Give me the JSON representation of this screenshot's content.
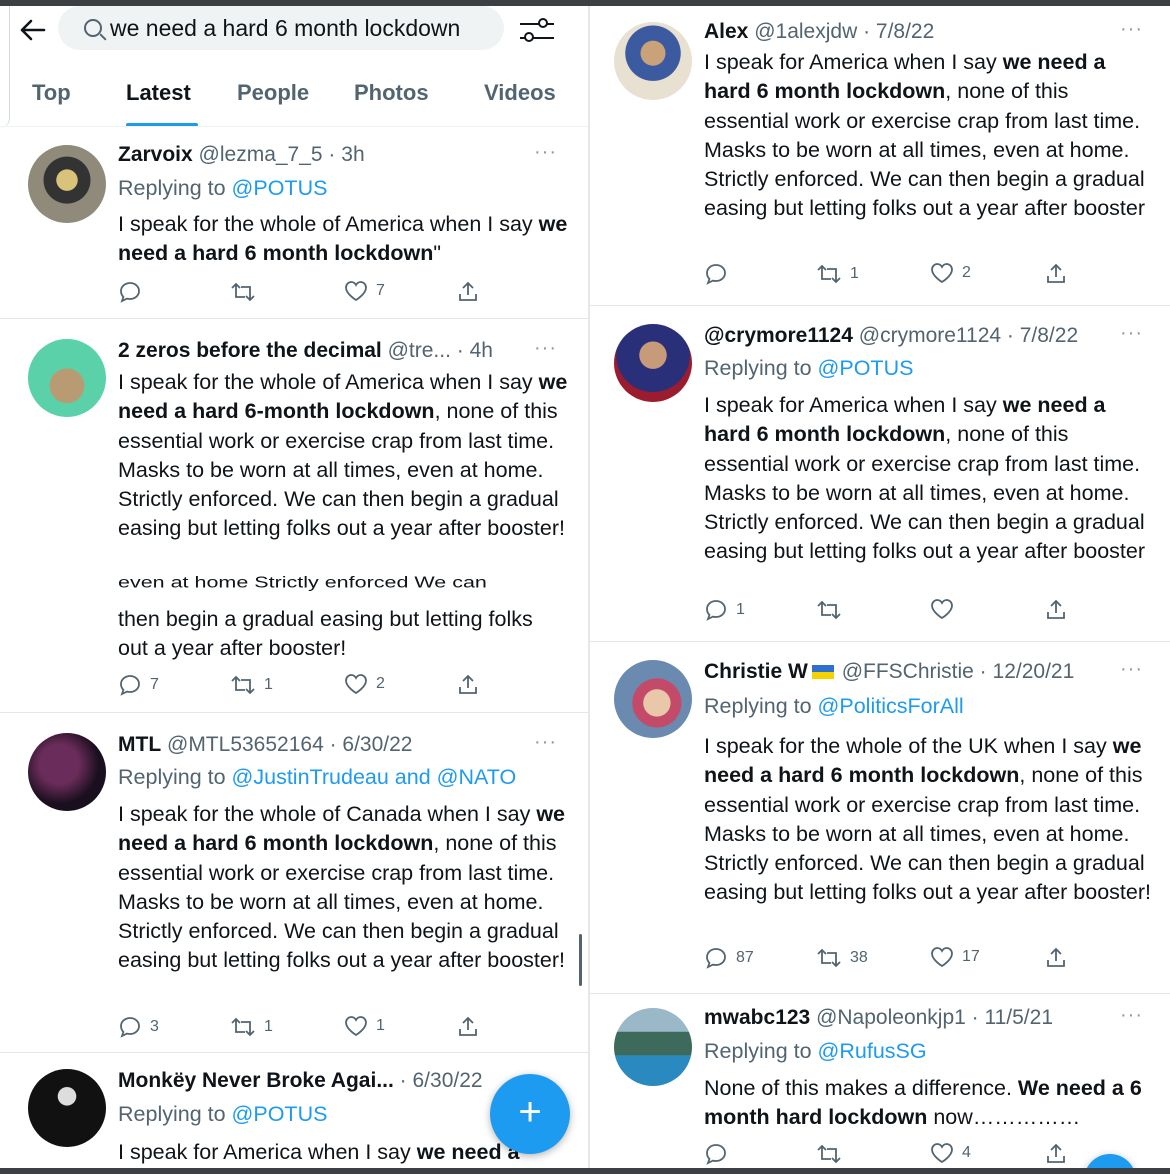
{
  "search": {
    "query": "we need a hard 6 month lockdown"
  },
  "tabs": [
    "Top",
    "Latest",
    "People",
    "Photos",
    "Videos"
  ],
  "colors": {
    "accent": "#1d9bf0",
    "text": "#0f1419",
    "muted": "#536471"
  },
  "left_tweets": [
    {
      "name": "Zarvoix",
      "meta": "@lezma_7_5 · 3h",
      "reply_prefix": "Replying to ",
      "reply_to": "@POTUS",
      "body_pre": "I speak for the whole of America when I say ",
      "body_bold": "we need a hard 6 month lockdown",
      "body_post": "\"",
      "counts": {
        "reply": "",
        "retweet": "",
        "like": "7"
      }
    },
    {
      "name": "2 zeros before the decimal",
      "meta": "@tre... · 4h",
      "body_pre": "I speak for the whole of America when I say ",
      "body_bold": "we need a hard 6-month lockdown",
      "body_post": ", none of this essential work or exercise crap from last time. Masks to be worn at all times, even at home. Strictly enforced. We can then begin a gradual easing but letting folks out a year after booster!",
      "overlap_line": "even at home Strictly enforced We can",
      "body_extra": "then begin a gradual easing but letting folks out a year after booster!",
      "counts": {
        "reply": "7",
        "retweet": "1",
        "like": "2"
      }
    },
    {
      "name": "MTL",
      "meta": "@MTL53652164 · 6/30/22",
      "reply_prefix": "Replying to ",
      "reply_to": "@JustinTrudeau and @NATO",
      "body_pre": "I speak for the whole of Canada when I say ",
      "body_bold": "we need a hard 6 month lockdown",
      "body_post": ", none of this essential work or exercise crap from last time. Masks to be worn at all times, even at home. Strictly enforced. We can then begin a gradual easing but letting folks out a year after booster!",
      "counts": {
        "reply": "3",
        "retweet": "1",
        "like": "1"
      }
    },
    {
      "name": "Monkëy Never Broke Agai...",
      "meta": "· 6/30/22",
      "reply_prefix": "Replying to ",
      "reply_to": "@POTUS",
      "body_pre": "I speak for America when I say ",
      "body_bold": "we need a"
    }
  ],
  "right_tweets": [
    {
      "name": "Alex",
      "meta": "@1alexjdw · 7/8/22",
      "body_pre": "I speak for America when I say ",
      "body_bold": "we need a hard 6 month lockdown",
      "body_post": ", none of this essential work or exercise crap from last time. Masks to be worn at all times, even at home. Strictly enforced. We can then begin a gradual easing but letting folks out a year after booster",
      "counts": {
        "reply": "",
        "retweet": "1",
        "like": "2"
      }
    },
    {
      "name": "@crymore1124",
      "meta": "@crymore1124 · 7/8/22",
      "reply_prefix": "Replying to ",
      "reply_to": "@POTUS",
      "body_pre": "I speak for America when I say ",
      "body_bold": "we need a hard 6 month lockdown",
      "body_post": ", none of this essential work or exercise crap from last time. Masks to be worn at all times, even at home. Strictly enforced. We can then begin a gradual easing but letting folks out a year after booster",
      "counts": {
        "reply": "1",
        "retweet": "",
        "like": ""
      }
    },
    {
      "name": "Christie W",
      "meta": "@FFSChristie · 12/20/21",
      "reply_prefix": "Replying to ",
      "reply_to": "@PoliticsForAll",
      "body_pre": "I speak for the whole of the UK when I say ",
      "body_bold": "we need a hard 6 month lockdown",
      "body_post": ", none of this essential work or exercise crap from last time. Masks to be worn at all times, even at home. Strictly enforced. We can then begin a gradual easing but letting folks out a year after booster!",
      "counts": {
        "reply": "87",
        "retweet": "38",
        "like": "17"
      }
    },
    {
      "name": "mwabc123",
      "meta": "@Napoleonkjp1 · 11/5/21",
      "reply_prefix": "Replying to ",
      "reply_to": "@RufusSG",
      "body_pre": "None of this makes a difference. ",
      "body_bold": "We need a 6 month hard lockdown",
      "body_post": " now……………",
      "counts": {
        "reply": "",
        "retweet": "",
        "like": "4"
      }
    }
  ],
  "fab_label": "+"
}
